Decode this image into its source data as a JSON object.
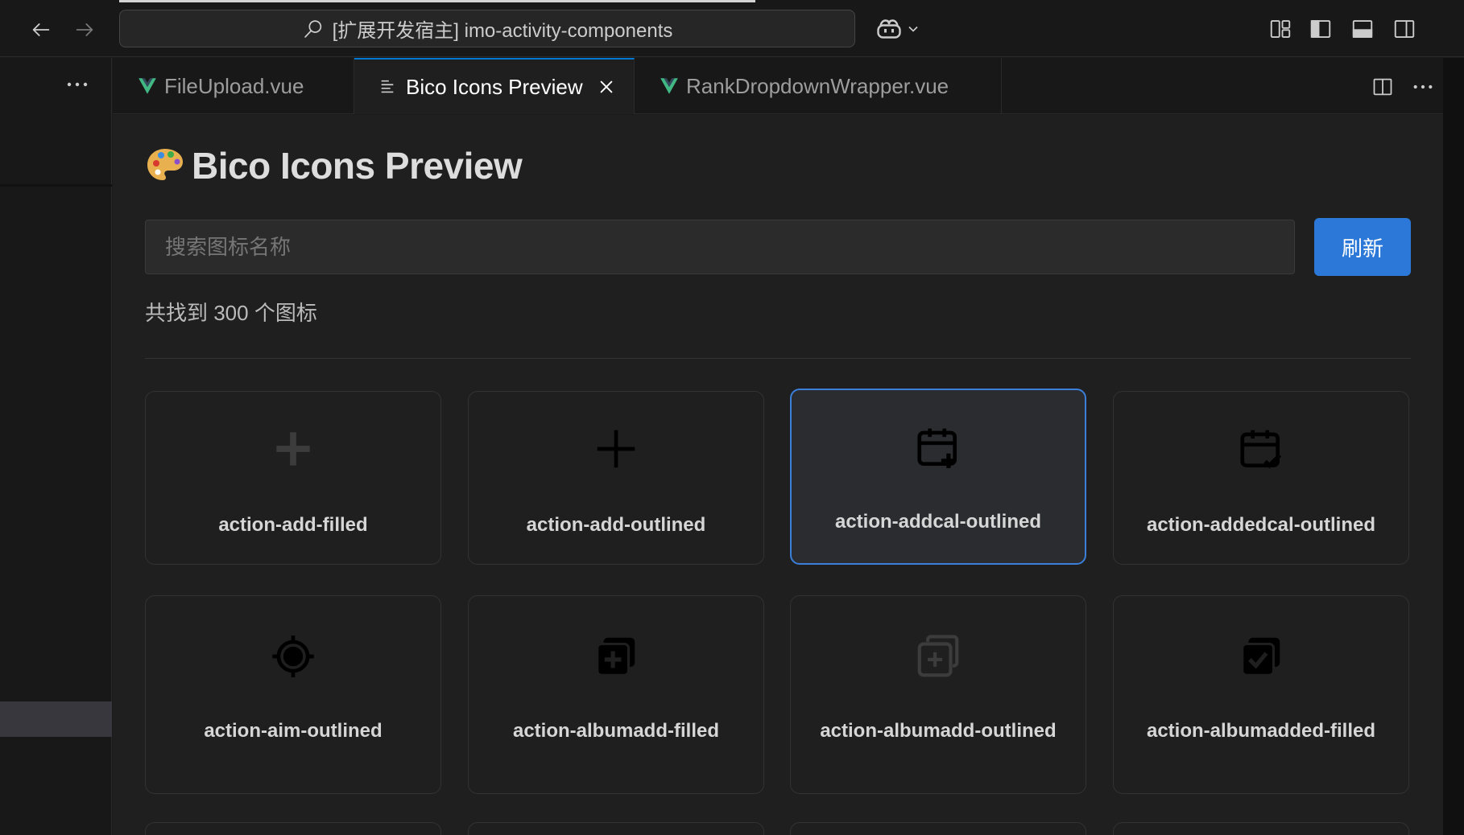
{
  "window": {
    "command_center": "[扩展开发宿主] imo-activity-components"
  },
  "tabs": [
    {
      "label": "FileUpload.vue",
      "active": false
    },
    {
      "label": "Bico Icons Preview",
      "active": true
    },
    {
      "label": "RankDropdownWrapper.vue",
      "active": false
    }
  ],
  "page": {
    "title": "Bico Icons Preview",
    "search_placeholder": "搜索图标名称",
    "search_value": "",
    "refresh_label": "刷新",
    "count_text": "共找到 300 个图标"
  },
  "icons": [
    {
      "name": "action-add-filled",
      "icon": "plus-filled-icon",
      "hovered": false
    },
    {
      "name": "action-add-outlined",
      "icon": "plus-outlined-icon",
      "hovered": false
    },
    {
      "name": "action-addcal-outlined",
      "icon": "calendar-add-icon",
      "hovered": true
    },
    {
      "name": "action-addedcal-outlined",
      "icon": "calendar-check-icon",
      "hovered": false
    },
    {
      "name": "action-aim-outlined",
      "icon": "crosshair-icon",
      "hovered": false
    },
    {
      "name": "action-albumadd-filled",
      "icon": "album-add-filled-icon",
      "hovered": false
    },
    {
      "name": "action-albumadd-outlined",
      "icon": "album-add-outlined-icon",
      "hovered": false
    },
    {
      "name": "action-albumadded-filled",
      "icon": "album-check-filled-icon",
      "hovered": false
    }
  ],
  "colors": {
    "accent": "#2b78d8",
    "active_tab_border": "#0078d4",
    "vue_green": "#41b883"
  }
}
